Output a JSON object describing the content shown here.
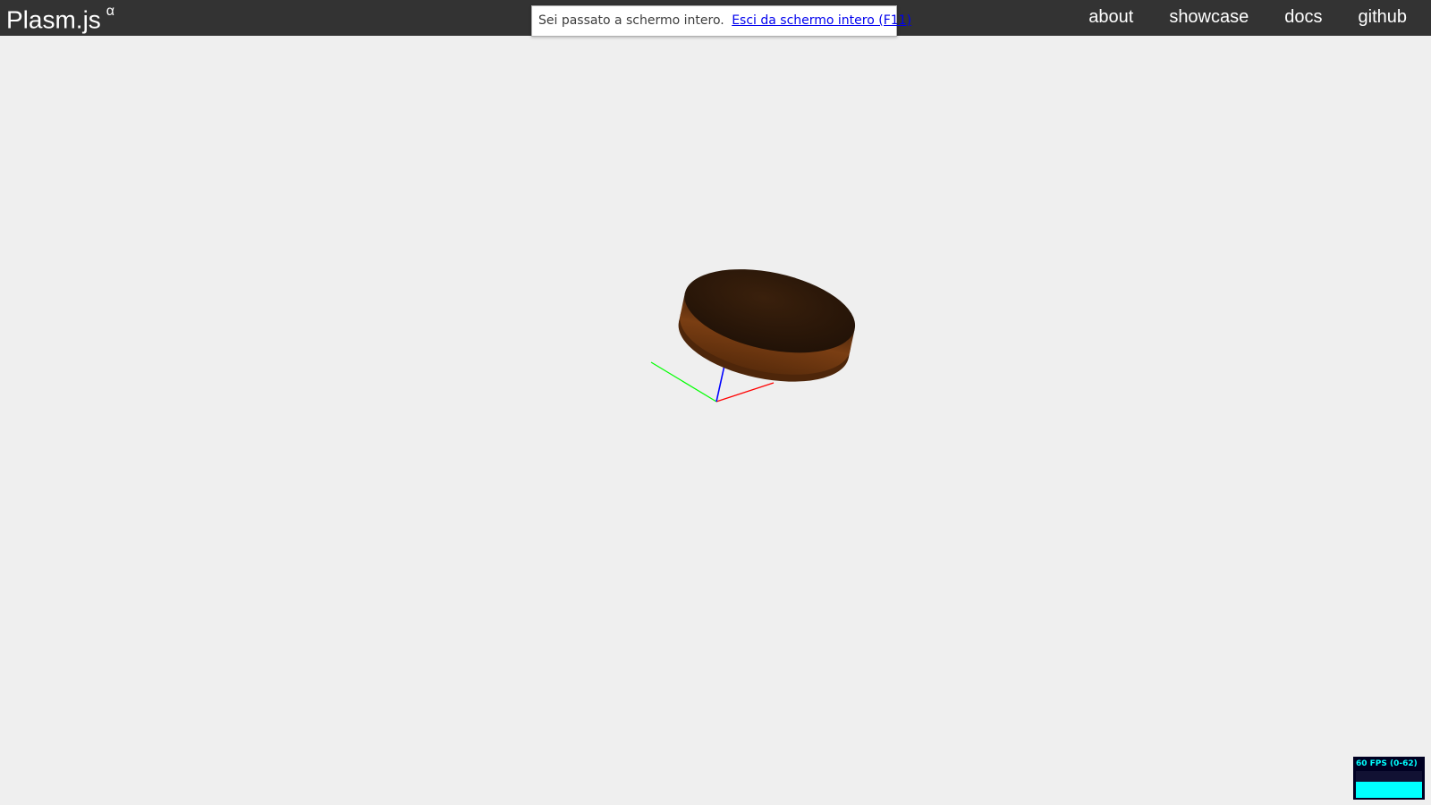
{
  "navbar": {
    "brand": "Plasm.js",
    "brand_superscript": "α",
    "links": [
      {
        "label": "about"
      },
      {
        "label": "showcase"
      },
      {
        "label": "docs"
      },
      {
        "label": "github"
      }
    ]
  },
  "fullscreen_notice": {
    "message": "Sei passato a schermo intero.",
    "exit_link": "Esci da schermo intero (F11)"
  },
  "viewport": {
    "object": "disc",
    "object_color": "#6b3410",
    "axes": {
      "x_color": "#ff0000",
      "y_color": "#00ff00",
      "z_color": "#0000ff"
    }
  },
  "stats": {
    "fps_text": "60 FPS (0-62)",
    "fps_current": 60,
    "fps_max": 62,
    "color": "#00ffff"
  }
}
